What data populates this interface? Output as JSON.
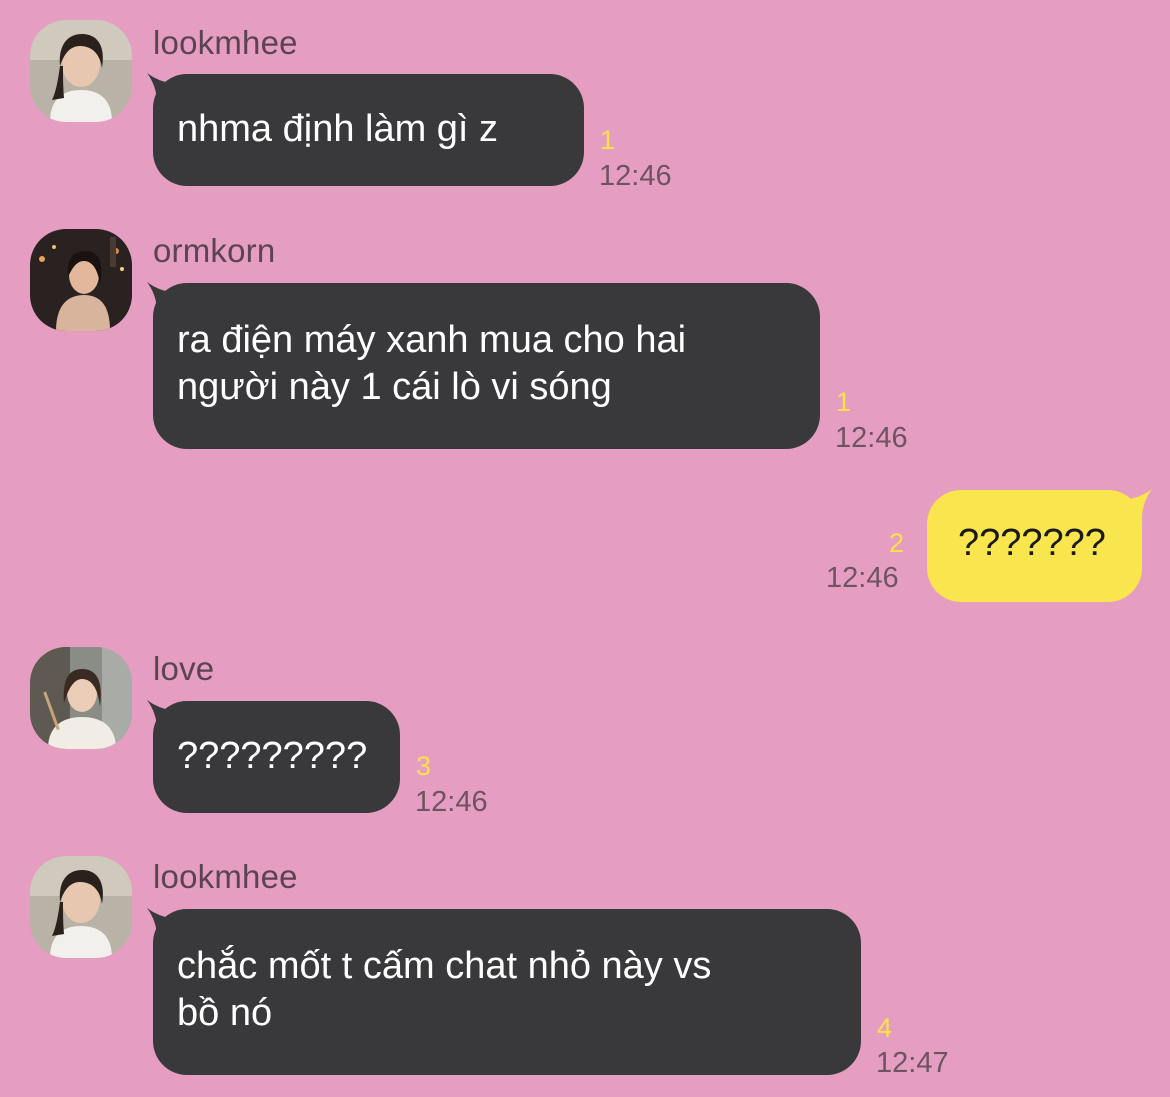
{
  "colors": {
    "background": "#E59EC1",
    "incoming_bubble": "#39393B",
    "outgoing_bubble": "#F9E54D",
    "unread_count": "#F8E24A",
    "timestamp": "#6E5361"
  },
  "messages": [
    {
      "sender": "lookmhee",
      "text": "nhma định làm gì z",
      "unread": "1",
      "time": "12:46"
    },
    {
      "sender": "ormkorn",
      "text": "ra điện máy xanh mua cho hai\nngười này 1 cái lò vi sóng",
      "unread": "1",
      "time": "12:46"
    },
    {
      "mine": true,
      "text": "???????",
      "unread": "2",
      "time": "12:46"
    },
    {
      "sender": "love",
      "text": "?????????",
      "unread": "3",
      "time": "12:46"
    },
    {
      "sender": "lookmhee",
      "text": "chắc mốt t cấm chat nhỏ này vs\nbồ nó",
      "unread": "4",
      "time": "12:47"
    }
  ]
}
